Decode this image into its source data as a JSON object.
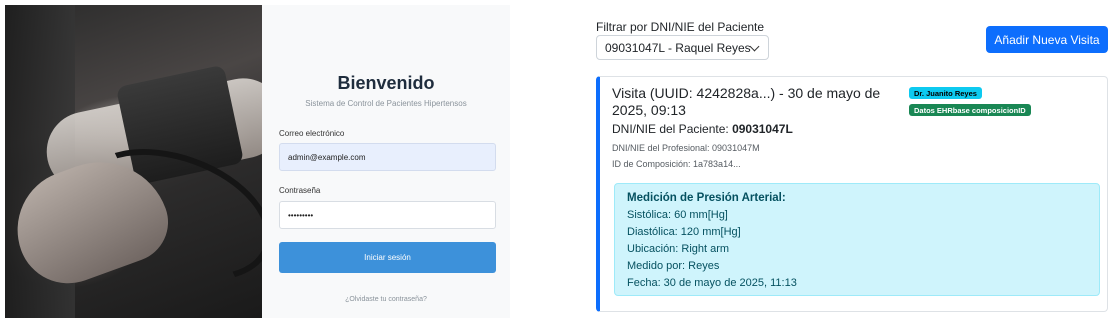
{
  "login": {
    "title": "Bienvenido",
    "subtitle": "Sistema de Control de Pacientes Hipertensos",
    "email_label": "Correo electrónico",
    "email_value": "admin@example.com",
    "password_label": "Contraseña",
    "password_value": "•••••••••",
    "submit_label": "Iniciar sesión",
    "forgot_label": "¿Olvidaste tu contraseña?"
  },
  "filter": {
    "label": "Filtrar por DNI/NIE del Paciente",
    "selected": "09031047L - Raquel Reyes"
  },
  "add_visit_label": "Añadir Nueva Visita",
  "visit": {
    "title": "Visita (UUID: 4242828a...) - 30 de mayo de 2025, 09:13",
    "doctor_badge": "Dr. Juanito Reyes",
    "ehr_badge": "Datos EHRbase composicionID",
    "patient_dni_label": "DNI/NIE del Paciente:",
    "patient_dni_value": "09031047L",
    "professional_dni": "DNI/NIE del Profesional: 09031047M",
    "composition_id": "ID de Composición: 1a783a14...",
    "measurement": {
      "title": "Medición de Presión Arterial:",
      "systolic": "Sistólica: 60 mm[Hg]",
      "diastolic": "Diastólica: 120 mm[Hg]",
      "location": "Ubicación: Right arm",
      "measured_by": "Medido por: Reyes",
      "date": "Fecha: 30 de mayo de 2025, 11:13"
    }
  },
  "colors": {
    "primary": "#0d6efd",
    "login_button": "#3d91da",
    "info_badge": "#0dcaf0",
    "success_badge": "#198754",
    "measurement_bg": "#cff4fc"
  }
}
